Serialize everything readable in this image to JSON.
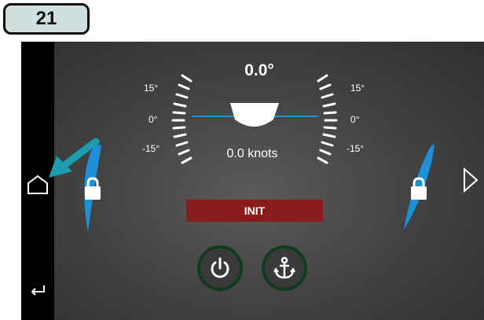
{
  "step": {
    "number": "21"
  },
  "display": {
    "heel_angle": "0.0°",
    "speed": "0.0 knots",
    "scale_labels_left": [
      "15°",
      "0°",
      "-15°"
    ],
    "scale_labels_right": [
      "15°",
      "0°",
      "-15°"
    ]
  },
  "buttons": {
    "init_label": "INIT"
  },
  "icons": {
    "home": "home-icon",
    "back": "back-icon",
    "next": "next-arrow-icon",
    "power": "power-icon",
    "anchor": "anchor-icon",
    "lock": "lock-icon",
    "pointer": "pointer-arrow-icon"
  },
  "colors": {
    "accent_blue": "#1e90d8",
    "init_red": "#8b1a1a",
    "button_ring": "#113b1c",
    "pointer_teal": "#1d9bb0"
  }
}
